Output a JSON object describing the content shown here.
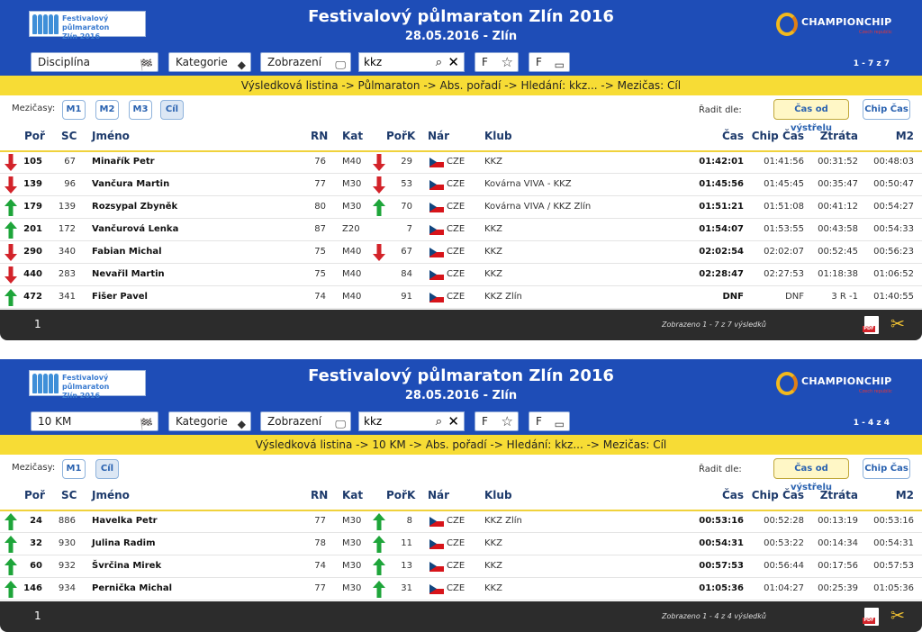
{
  "panels": [
    {
      "logo": {
        "line1": "Festivalový půlmaraton",
        "line2": "Zlín 2016"
      },
      "title": "Festivalový půlmaraton Zlín 2016",
      "date": "28.05.2016 - Zlín",
      "brand": {
        "name": "CHAMPIONCHIP",
        "sub": "Czech republic"
      },
      "toolbar": {
        "discipline": "Disciplína",
        "category": "Kategorie",
        "display": "Zobrazení",
        "search_value": "kkz",
        "f1": "F",
        "f2": "F",
        "count": "1 - 7 z 7"
      },
      "breadcrumb": "Výsledková listina -> Půlmaraton -> Abs. pořadí -> Hledání: kkz... -> Mezičas: Cíl",
      "splits_label": "Mezičasy:",
      "splits": [
        "M1",
        "M2",
        "M3",
        "Cíl"
      ],
      "sort_label": "Řadit dle:",
      "sort_gun": "Čas od výstřelu",
      "sort_chip": "Chip Čas",
      "headers": {
        "por": "Poř",
        "sc": "SC",
        "name": "Jméno",
        "rn": "RN",
        "kat": "Kat",
        "pork": "PořK",
        "nar": "Nár",
        "club": "Klub",
        "cas": "Čas",
        "chip": "Chip Čas",
        "ztrata": "Ztráta",
        "m": "M2"
      },
      "rows": [
        {
          "dir": "down",
          "por": "105",
          "sc": "67",
          "name": "Minařík Petr",
          "rn": "76",
          "kat": "M40",
          "kdir": "down",
          "pork": "29",
          "nar": "CZE",
          "club": "KKZ",
          "cas": "01:42:01",
          "chip": "01:41:56",
          "ztrata": "00:31:52",
          "m": "00:48:03"
        },
        {
          "dir": "down",
          "por": "139",
          "sc": "96",
          "name": "Vančura Martin",
          "rn": "77",
          "kat": "M30",
          "kdir": "down",
          "pork": "53",
          "nar": "CZE",
          "club": "Kovárna VIVA - KKZ",
          "cas": "01:45:56",
          "chip": "01:45:45",
          "ztrata": "00:35:47",
          "m": "00:50:47"
        },
        {
          "dir": "up",
          "por": "179",
          "sc": "139",
          "name": "Rozsypal Zbyněk",
          "rn": "80",
          "kat": "M30",
          "kdir": "up",
          "pork": "70",
          "nar": "CZE",
          "club": "Kovárna VIVA / KKZ Zlín",
          "cas": "01:51:21",
          "chip": "01:51:08",
          "ztrata": "00:41:12",
          "m": "00:54:27"
        },
        {
          "dir": "up",
          "por": "201",
          "sc": "172",
          "name": "Vančurová Lenka",
          "rn": "87",
          "kat": "Z20",
          "kdir": "",
          "pork": "7",
          "nar": "CZE",
          "club": "KKZ",
          "cas": "01:54:07",
          "chip": "01:53:55",
          "ztrata": "00:43:58",
          "m": "00:54:33"
        },
        {
          "dir": "down",
          "por": "290",
          "sc": "340",
          "name": "Fabian Michal",
          "rn": "75",
          "kat": "M40",
          "kdir": "down",
          "pork": "67",
          "nar": "CZE",
          "club": "KKZ",
          "cas": "02:02:54",
          "chip": "02:02:07",
          "ztrata": "00:52:45",
          "m": "00:56:23"
        },
        {
          "dir": "down",
          "por": "440",
          "sc": "283",
          "name": "Nevařil Martin",
          "rn": "75",
          "kat": "M40",
          "kdir": "",
          "pork": "84",
          "nar": "CZE",
          "club": "KKZ",
          "cas": "02:28:47",
          "chip": "02:27:53",
          "ztrata": "01:18:38",
          "m": "01:06:52"
        },
        {
          "dir": "up",
          "por": "472",
          "sc": "341",
          "name": "Fišer Pavel",
          "rn": "74",
          "kat": "M40",
          "kdir": "",
          "pork": "91",
          "nar": "CZE",
          "club": "KKZ Zlín",
          "cas": "DNF",
          "chip": "DNF",
          "ztrata": "3 R -1",
          "m": "01:40:55"
        }
      ],
      "footer": {
        "page": "1",
        "shown": "Zobrazeno 1 - 7 z 7 výsledků"
      }
    },
    {
      "logo": {
        "line1": "Festivalový půlmaraton",
        "line2": "Zlín 2016"
      },
      "title": "Festivalový půlmaraton Zlín 2016",
      "date": "28.05.2016 - Zlín",
      "brand": {
        "name": "CHAMPIONCHIP",
        "sub": "Czech republic"
      },
      "toolbar": {
        "discipline": "10 KM",
        "category": "Kategorie",
        "display": "Zobrazení",
        "search_value": "kkz",
        "f1": "F",
        "f2": "F",
        "count": "1 - 4 z 4"
      },
      "breadcrumb": "Výsledková listina -> 10 KM -> Abs. pořadí -> Hledání: kkz... -> Mezičas: Cíl",
      "splits_label": "Mezičasy:",
      "splits": [
        "M1",
        "Cíl"
      ],
      "sort_label": "Řadit dle:",
      "sort_gun": "Čas od výstřelu",
      "sort_chip": "Chip Čas",
      "headers": {
        "por": "Poř",
        "sc": "SC",
        "name": "Jméno",
        "rn": "RN",
        "kat": "Kat",
        "pork": "PořK",
        "nar": "Nár",
        "club": "Klub",
        "cas": "Čas",
        "chip": "Chip Čas",
        "ztrata": "Ztráta",
        "m": "M2"
      },
      "rows": [
        {
          "dir": "up",
          "por": "24",
          "sc": "886",
          "name": "Havelka Petr",
          "rn": "77",
          "kat": "M30",
          "kdir": "up",
          "pork": "8",
          "nar": "CZE",
          "club": "KKZ Zlín",
          "cas": "00:53:16",
          "chip": "00:52:28",
          "ztrata": "00:13:19",
          "m": "00:53:16"
        },
        {
          "dir": "up",
          "por": "32",
          "sc": "930",
          "name": "Julina Radim",
          "rn": "78",
          "kat": "M30",
          "kdir": "up",
          "pork": "11",
          "nar": "CZE",
          "club": "KKZ",
          "cas": "00:54:31",
          "chip": "00:53:22",
          "ztrata": "00:14:34",
          "m": "00:54:31"
        },
        {
          "dir": "up",
          "por": "60",
          "sc": "932",
          "name": "Švrčina Mirek",
          "rn": "74",
          "kat": "M30",
          "kdir": "up",
          "pork": "13",
          "nar": "CZE",
          "club": "KKZ",
          "cas": "00:57:53",
          "chip": "00:56:44",
          "ztrata": "00:17:56",
          "m": "00:57:53"
        },
        {
          "dir": "up",
          "por": "146",
          "sc": "934",
          "name": "Pernička Michal",
          "rn": "77",
          "kat": "M30",
          "kdir": "up",
          "pork": "31",
          "nar": "CZE",
          "club": "KKZ",
          "cas": "01:05:36",
          "chip": "01:04:27",
          "ztrata": "00:25:39",
          "m": "01:05:36"
        }
      ],
      "footer": {
        "page": "1",
        "shown": "Zobrazeno 1 - 4 z 4 výsledků"
      }
    }
  ],
  "colors": {
    "header": "#1e4db7",
    "bread": "#f7dc35",
    "up": "#1ea53a",
    "down": "#d3232a"
  }
}
